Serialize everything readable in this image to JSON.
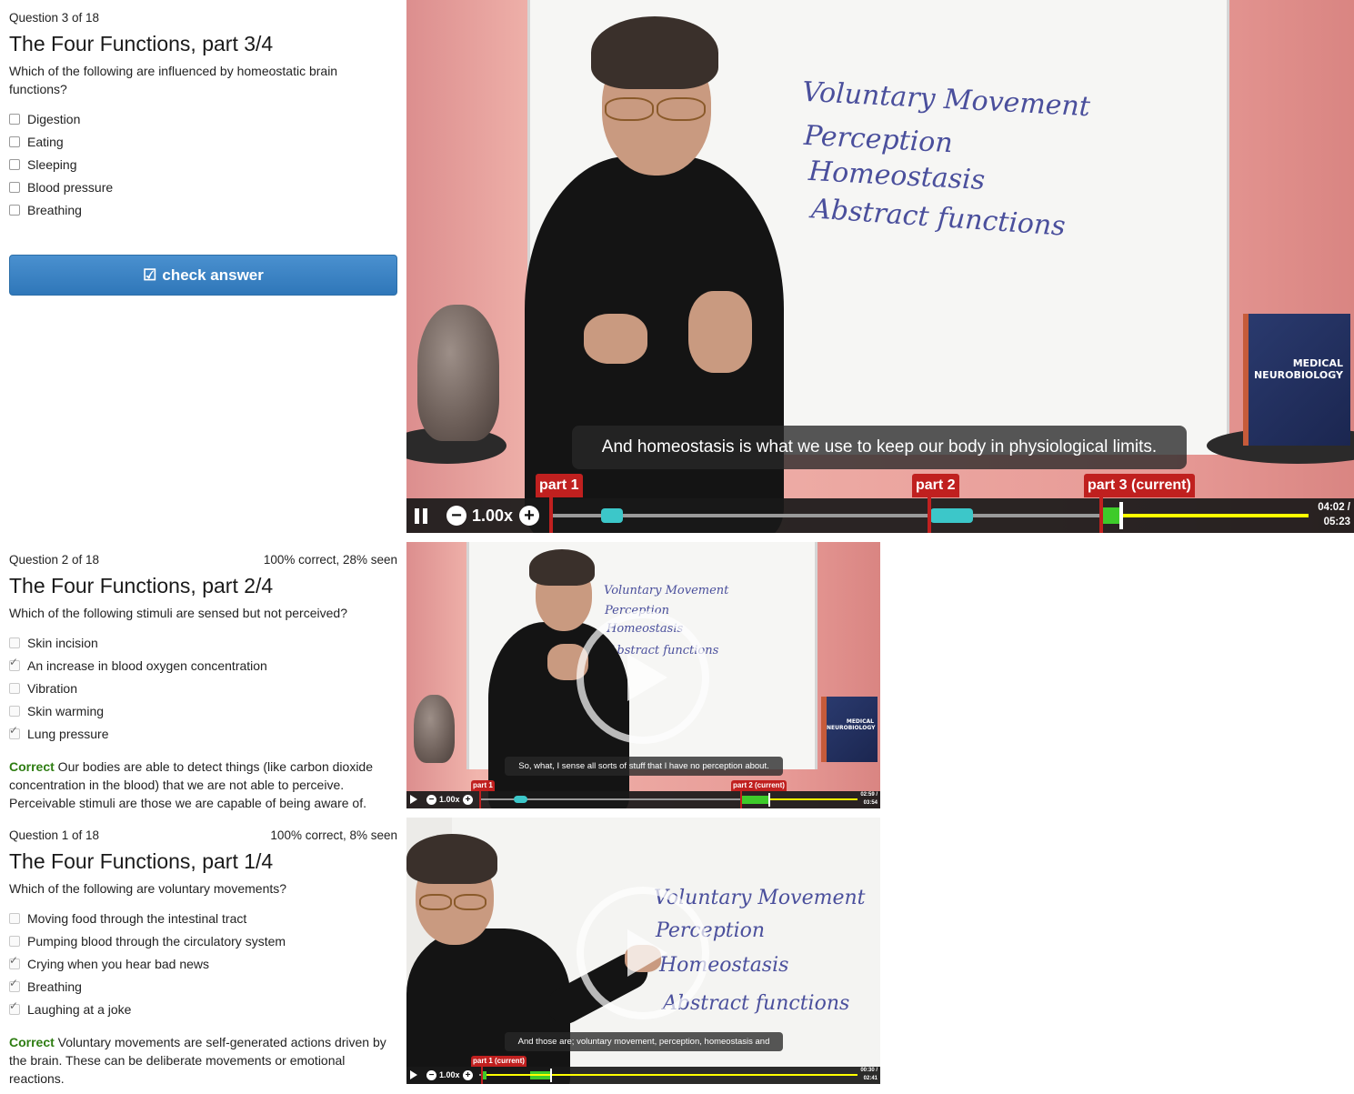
{
  "q3": {
    "counter": "Question 3 of 18",
    "title": "The Four Functions, part 3/4",
    "question": "Which of the following are influenced by homeostatic brain functions?",
    "options": [
      "Digestion",
      "Eating",
      "Sleeping",
      "Blood pressure",
      "Breathing"
    ],
    "check_label": "check answer",
    "check_icon": "check-square-icon",
    "video": {
      "whiteboard": [
        "Voluntary Movement",
        "Perception",
        "Homeostasis",
        "Abstract functions"
      ],
      "caption": "And homeostasis is what we use to keep our body in physiological limits.",
      "speed": "1.00x",
      "markers": [
        "part 1",
        "part 2",
        "part 3 (current)"
      ],
      "time_current": "04:02 /",
      "time_total": "05:23",
      "book_title": "MEDICAL\nNEUROBIOLOGY"
    }
  },
  "q2": {
    "counter": "Question 2 of 18",
    "stats": "100% correct, 28% seen",
    "title": "The Four Functions, part 2/4",
    "question": "Which of the following stimuli are sensed but not perceived?",
    "options": [
      {
        "label": "Skin incision",
        "checked": false
      },
      {
        "label": "An increase in blood oxygen concentration",
        "checked": true
      },
      {
        "label": "Vibration",
        "checked": false
      },
      {
        "label": "Skin warming",
        "checked": false
      },
      {
        "label": "Lung pressure",
        "checked": true
      }
    ],
    "feedback_status": "Correct",
    "feedback_text": " Our bodies are able to detect things (like carbon dioxide concentration in the blood) that we are not able to perceive. Perceivable stimuli are those we are capable of being aware of.",
    "video": {
      "caption": "So, what, I sense all sorts of stuff that I have no perception about.",
      "speed": "1.00x",
      "markers": [
        "part 1",
        "part 2 (current)"
      ],
      "time_current": "02:59 /",
      "time_total": "03:54"
    }
  },
  "q1": {
    "counter": "Question 1 of 18",
    "stats": "100% correct, 8% seen",
    "title": "The Four Functions, part 1/4",
    "question": "Which of the following are voluntary movements?",
    "options": [
      {
        "label": "Moving food through the intestinal tract",
        "checked": false
      },
      {
        "label": "Pumping blood through the circulatory system",
        "checked": false
      },
      {
        "label": "Crying when you hear bad news",
        "checked": true
      },
      {
        "label": "Breathing",
        "checked": true
      },
      {
        "label": "Laughing at a joke",
        "checked": true
      }
    ],
    "feedback_status": "Correct",
    "feedback_text": " Voluntary movements are self-generated actions driven by the brain. These can be deliberate movements or emotional reactions.",
    "video": {
      "caption": "And those are; voluntary movement, perception, homeostasis and",
      "speed": "1.00x",
      "markers": [
        "part 1 (current)"
      ],
      "time_current": "00:30 /",
      "time_total": "02:41"
    }
  },
  "colors": {
    "button": "#3a82c4",
    "correct": "#2e7d12",
    "marker": "#c0201f",
    "played": "#ffff00",
    "seen": "#3cc7c9",
    "current": "#3ecb2a"
  }
}
